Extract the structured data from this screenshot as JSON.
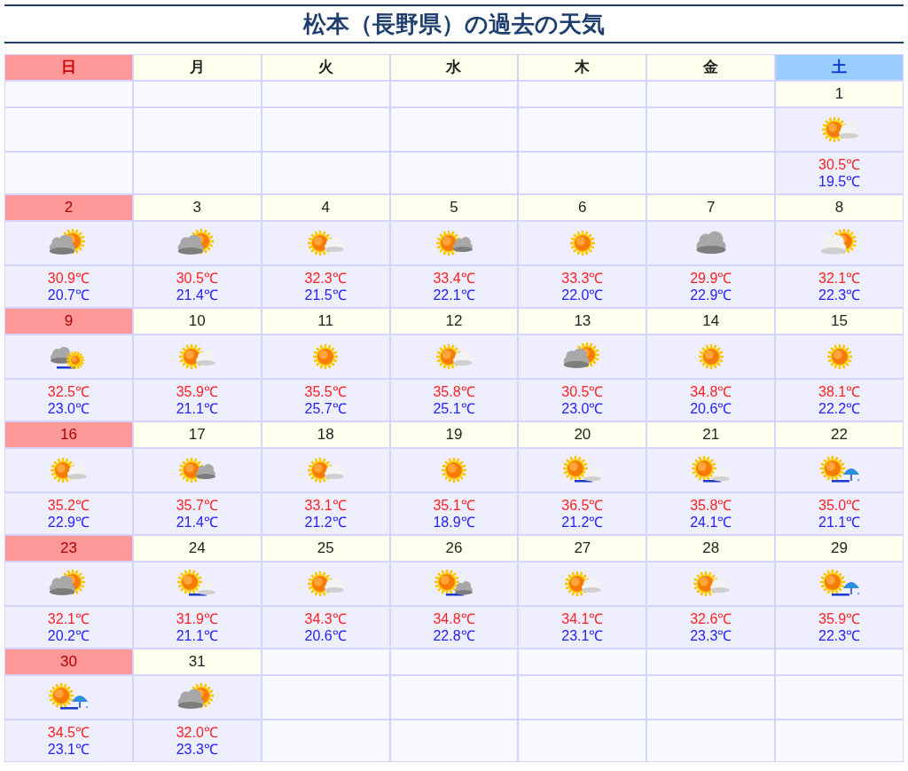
{
  "title": "松本（長野県）の過去の天気",
  "weekdays": [
    {
      "label": "日",
      "kind": "sunday"
    },
    {
      "label": "月",
      "kind": "weekday"
    },
    {
      "label": "火",
      "kind": "weekday"
    },
    {
      "label": "水",
      "kind": "weekday"
    },
    {
      "label": "木",
      "kind": "weekday"
    },
    {
      "label": "金",
      "kind": "weekday"
    },
    {
      "label": "土",
      "kind": "saturday"
    }
  ],
  "weeks": [
    [
      {
        "kind": "blank"
      },
      {
        "kind": "blank"
      },
      {
        "kind": "blank"
      },
      {
        "kind": "blank"
      },
      {
        "kind": "blank"
      },
      {
        "kind": "blank"
      },
      {
        "day": "1",
        "holiday": false,
        "kind": "sun-cloud",
        "high": "30.5℃",
        "low": "19.5℃"
      }
    ],
    [
      {
        "day": "2",
        "holiday": true,
        "kind": "cloud-sun",
        "high": "30.9℃",
        "low": "20.7℃"
      },
      {
        "day": "3",
        "holiday": false,
        "kind": "cloud-sun",
        "high": "30.5℃",
        "low": "21.4℃"
      },
      {
        "day": "4",
        "holiday": false,
        "kind": "sun-cloud",
        "high": "32.3℃",
        "low": "21.5℃"
      },
      {
        "day": "5",
        "holiday": false,
        "kind": "sun-darkcloud",
        "high": "33.4℃",
        "low": "22.1℃"
      },
      {
        "day": "6",
        "holiday": false,
        "kind": "sun",
        "high": "33.3℃",
        "low": "22.0℃"
      },
      {
        "day": "7",
        "holiday": false,
        "kind": "cloud",
        "high": "29.9℃",
        "low": "22.9℃"
      },
      {
        "day": "8",
        "holiday": false,
        "kind": "lightcloud-sun",
        "high": "32.1℃",
        "low": "22.3℃"
      }
    ],
    [
      {
        "day": "9",
        "holiday": true,
        "kind": "cloud-line-sun",
        "high": "32.5℃",
        "low": "23.0℃"
      },
      {
        "day": "10",
        "holiday": false,
        "kind": "sun-cloud",
        "high": "35.9℃",
        "low": "21.1℃"
      },
      {
        "day": "11",
        "holiday": false,
        "kind": "sun",
        "high": "35.5℃",
        "low": "25.7℃"
      },
      {
        "day": "12",
        "holiday": false,
        "kind": "sun-cloud",
        "high": "35.8℃",
        "low": "25.1℃"
      },
      {
        "day": "13",
        "holiday": false,
        "kind": "cloud-sun",
        "high": "30.5℃",
        "low": "23.0℃"
      },
      {
        "day": "14",
        "holiday": false,
        "kind": "sun",
        "high": "34.8℃",
        "low": "20.6℃"
      },
      {
        "day": "15",
        "holiday": false,
        "kind": "sun",
        "high": "38.1℃",
        "low": "22.2℃"
      }
    ],
    [
      {
        "day": "16",
        "holiday": true,
        "kind": "sun-cloud",
        "high": "35.2℃",
        "low": "22.9℃"
      },
      {
        "day": "17",
        "holiday": false,
        "kind": "sun-darkcloud",
        "high": "35.7℃",
        "low": "21.4℃"
      },
      {
        "day": "18",
        "holiday": false,
        "kind": "sun-cloud",
        "high": "33.1℃",
        "low": "21.2℃"
      },
      {
        "day": "19",
        "holiday": false,
        "kind": "sun",
        "high": "35.1℃",
        "low": "18.9℃"
      },
      {
        "day": "20",
        "holiday": false,
        "kind": "sun-line-cloud",
        "high": "36.5℃",
        "low": "21.2℃"
      },
      {
        "day": "21",
        "holiday": false,
        "kind": "sun-line-cloud",
        "high": "35.8℃",
        "low": "24.1℃"
      },
      {
        "day": "22",
        "holiday": false,
        "kind": "sun-line-rain",
        "high": "35.0℃",
        "low": "21.1℃"
      }
    ],
    [
      {
        "day": "23",
        "holiday": true,
        "kind": "cloud-sun",
        "high": "32.1℃",
        "low": "20.2℃"
      },
      {
        "day": "24",
        "holiday": false,
        "kind": "sun-line-cloud",
        "high": "31.9℃",
        "low": "21.1℃"
      },
      {
        "day": "25",
        "holiday": false,
        "kind": "sun-cloud",
        "high": "34.3℃",
        "low": "20.6℃"
      },
      {
        "day": "26",
        "holiday": false,
        "kind": "sun-line-darkcloud",
        "high": "34.8℃",
        "low": "22.8℃"
      },
      {
        "day": "27",
        "holiday": false,
        "kind": "sun-cloud",
        "high": "34.1℃",
        "low": "23.1℃"
      },
      {
        "day": "28",
        "holiday": false,
        "kind": "sun-cloud",
        "high": "32.6℃",
        "low": "23.3℃"
      },
      {
        "day": "29",
        "holiday": false,
        "kind": "sun-line-rain",
        "high": "35.9℃",
        "low": "22.3℃"
      }
    ],
    [
      {
        "day": "30",
        "holiday": true,
        "kind": "sun-line-rain",
        "high": "34.5℃",
        "low": "23.1℃"
      },
      {
        "day": "31",
        "holiday": false,
        "kind": "cloud-sun",
        "high": "32.0℃",
        "low": "23.3℃"
      },
      {
        "kind": "blank"
      },
      {
        "kind": "blank"
      },
      {
        "kind": "blank"
      },
      {
        "kind": "blank"
      },
      {
        "kind": "blank"
      }
    ]
  ]
}
